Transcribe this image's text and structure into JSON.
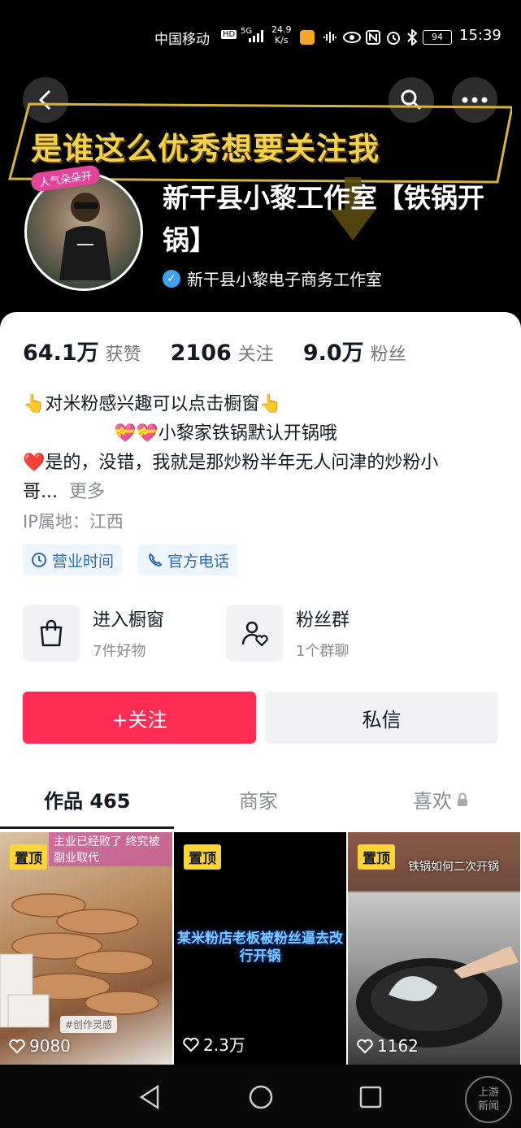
{
  "status_bar": {
    "carrier": "中国移动",
    "hd": "HD",
    "network": "5G",
    "speed_top": "24.9",
    "speed_unit": "K/s",
    "battery": "94",
    "time": "15:39"
  },
  "header": {
    "banner_text": "是谁这么优秀想要关注我",
    "avatar_badge": "人气朵朵开",
    "profile_name": "新干县小黎工作室【铁锅开锅】",
    "verified_label": "新干县小黎电子商务工作室"
  },
  "stats": [
    {
      "value": "64.1万",
      "label": "获赞"
    },
    {
      "value": "2106",
      "label": "关注"
    },
    {
      "value": "9.0万",
      "label": "粉丝"
    }
  ],
  "bio": {
    "line1": "👆对米粉感兴趣可以点击橱窗👆",
    "line2": "💝💝小黎家铁锅默认开锅哦",
    "line3": "❤️是的，没错，我就是那炒粉半年无人问津的炒粉小",
    "line4": "哥...",
    "more": "更多",
    "ip": "IP属地：江西"
  },
  "tags": {
    "hours": "营业时间",
    "phone": "官方电话"
  },
  "entries": {
    "shop_title": "进入橱窗",
    "shop_sub": "7件好物",
    "fans_title": "粉丝群",
    "fans_sub": "1个群聊"
  },
  "actions": {
    "follow": "+关注",
    "message": "私信"
  },
  "tabs": {
    "works": "作品 465",
    "merchant": "商家",
    "likes": "喜欢"
  },
  "videos": [
    {
      "pin": "置顶",
      "overlay": "主业已经败了 终究被副业取代",
      "tag": "#创作灵感",
      "likes": "9080"
    },
    {
      "pin": "置顶",
      "overlay": "某米粉店老板被粉丝逼去改行开锅",
      "likes": "2.3万"
    },
    {
      "pin": "置顶",
      "overlay": "铁锅如何二次开锅",
      "likes": "1162"
    }
  ],
  "watermark": "上游新闻"
}
